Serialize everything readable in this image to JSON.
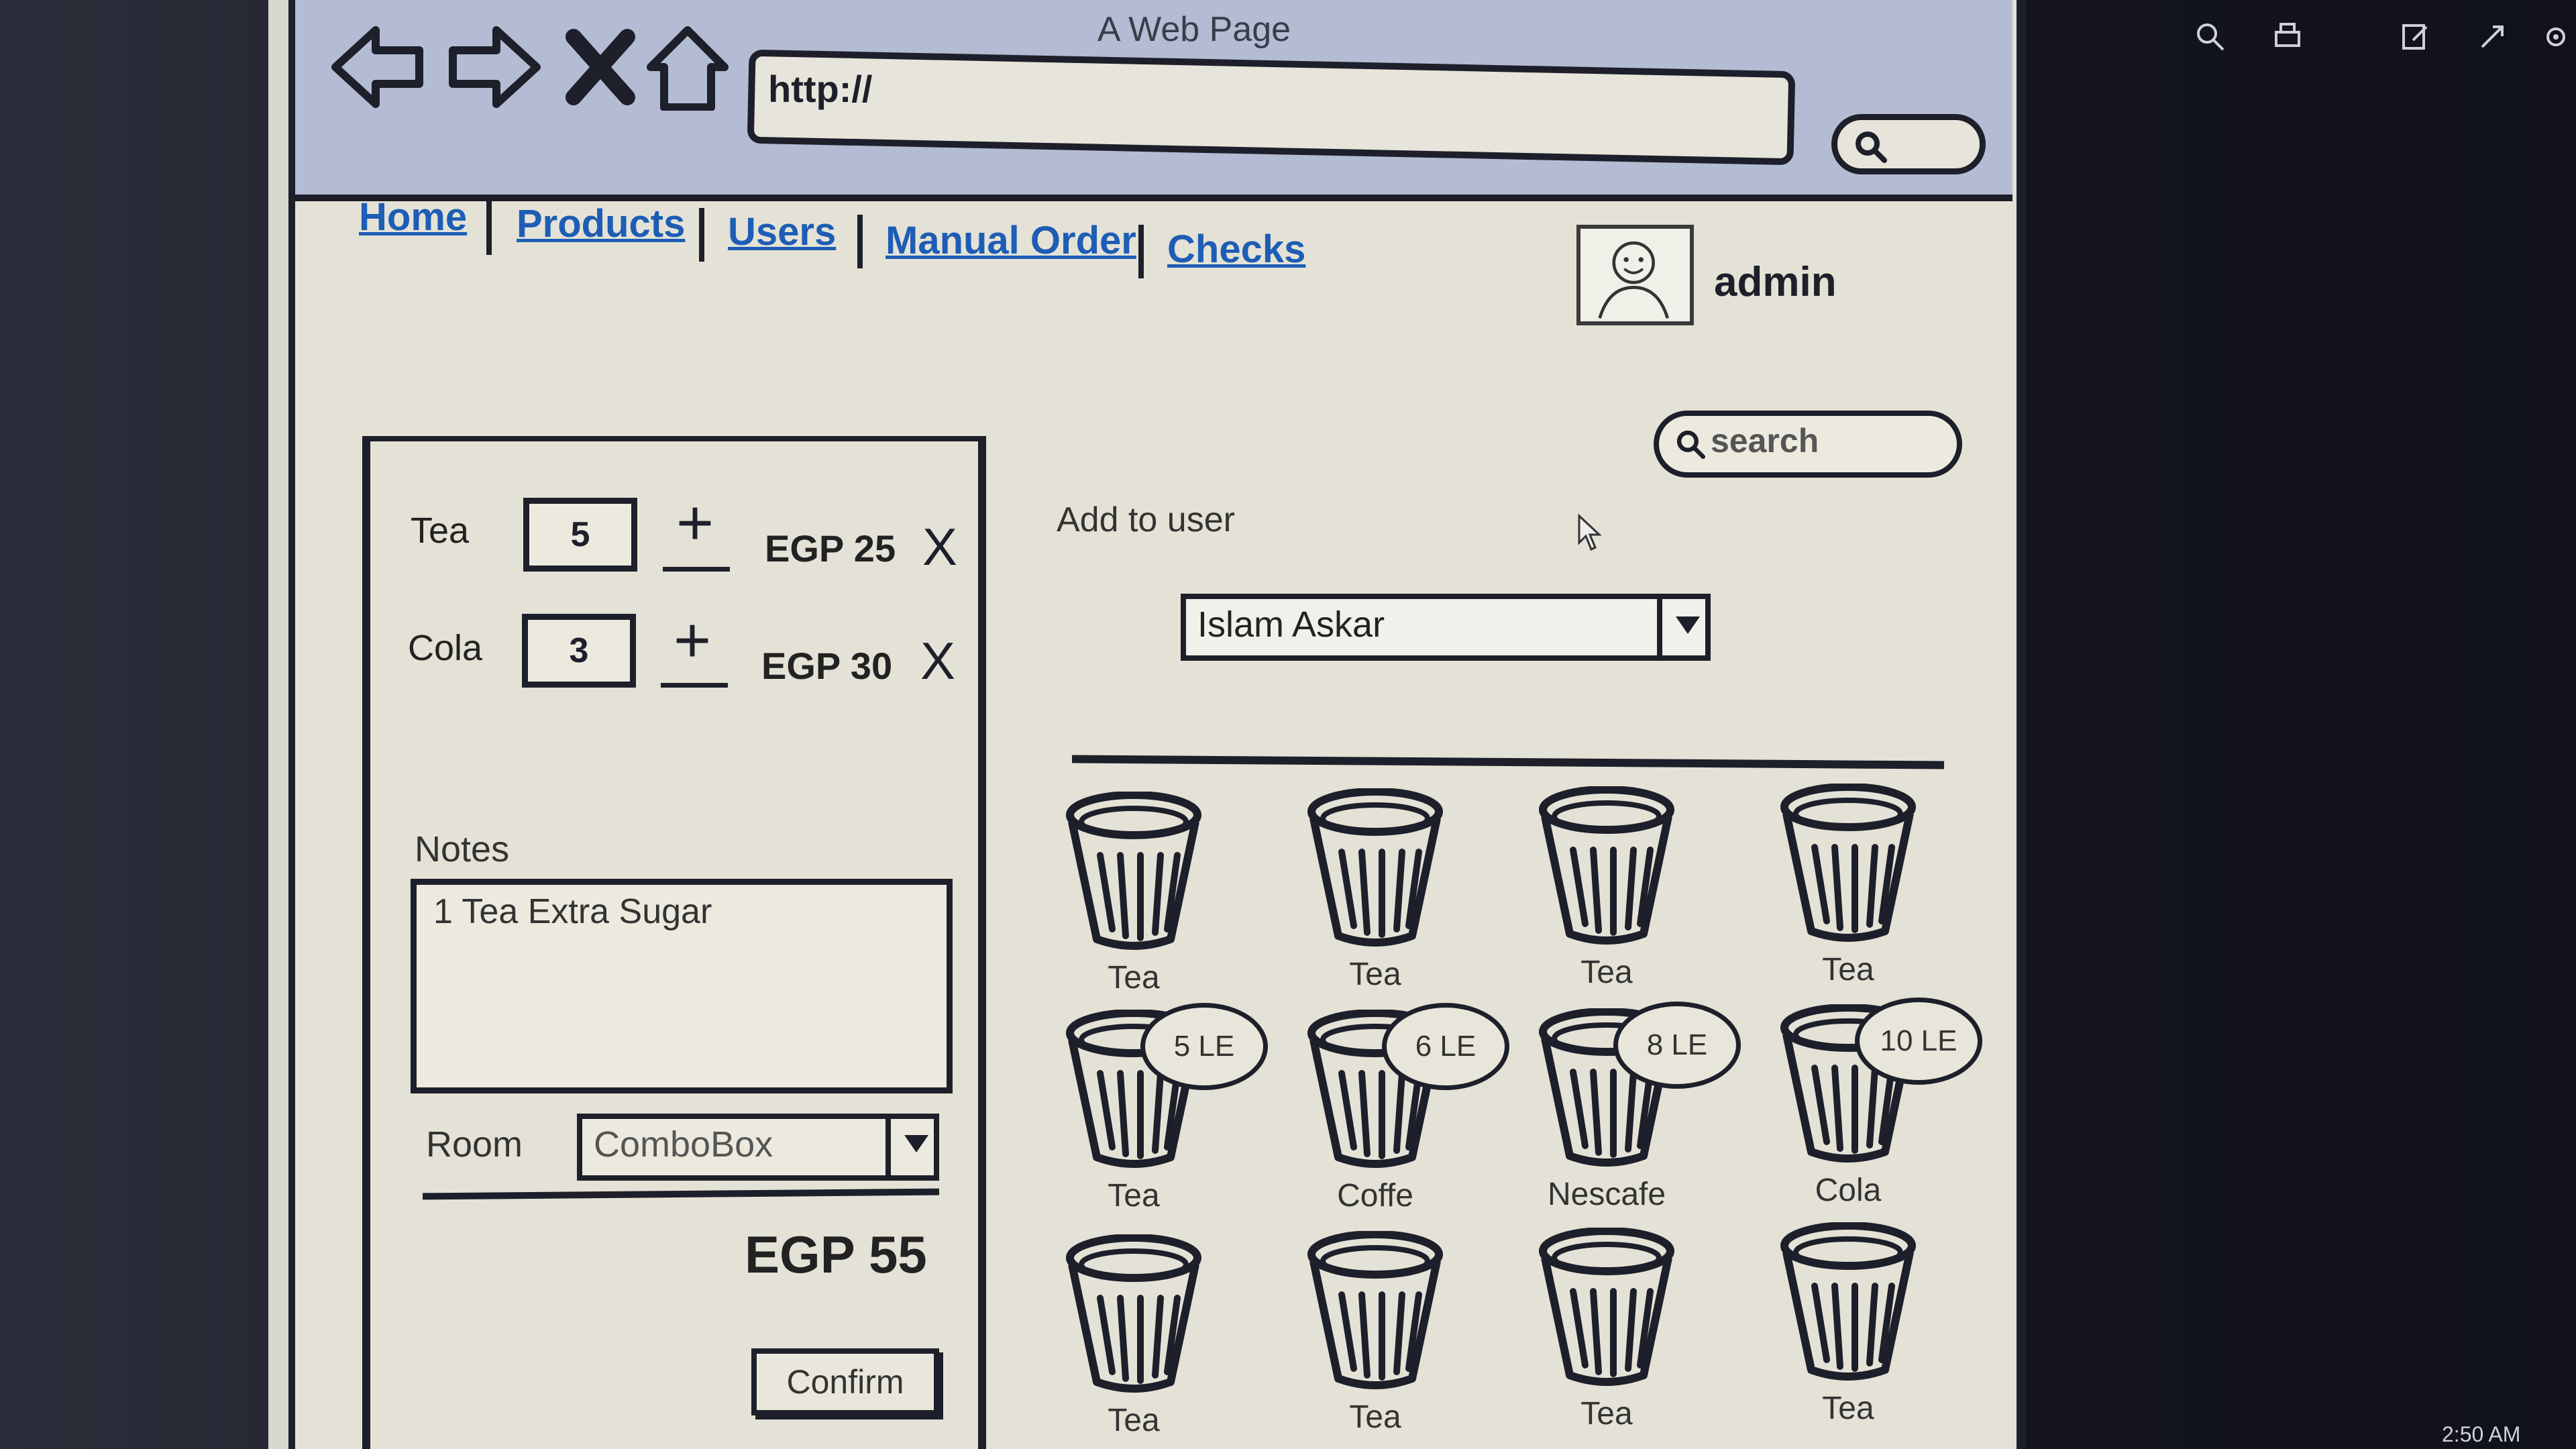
{
  "window": {
    "title": "A Web Page"
  },
  "browser": {
    "url": "http://",
    "icons": [
      "back-arrow-icon",
      "forward-arrow-icon",
      "stop-icon",
      "home-icon",
      "search-icon"
    ]
  },
  "nav": {
    "items": [
      {
        "label": "Home"
      },
      {
        "label": "Products"
      },
      {
        "label": "Users"
      },
      {
        "label": "Manual Order"
      },
      {
        "label": "Checks"
      }
    ]
  },
  "user": {
    "name": "admin"
  },
  "order": {
    "items": [
      {
        "name": "Tea",
        "quantity": "5",
        "price": "EGP 25",
        "remove": "X"
      },
      {
        "name": "Cola",
        "quantity": "3",
        "price": "EGP 30",
        "remove": "X"
      }
    ],
    "notes_label": "Notes",
    "notes_value": "1 Tea Extra Sugar",
    "room_label": "Room",
    "room_value": "ComboBox",
    "total": "EGP 55",
    "confirm_label": "Confirm"
  },
  "search": {
    "placeholder": "search"
  },
  "add_to_user": {
    "label": "Add to user",
    "selected": "Islam Askar"
  },
  "products": [
    {
      "name": "Tea"
    },
    {
      "name": "Tea"
    },
    {
      "name": "Tea"
    },
    {
      "name": "Tea"
    },
    {
      "name": "Tea",
      "price": "5 LE"
    },
    {
      "name": "Coffe",
      "price": "6 LE"
    },
    {
      "name": "Nescafe",
      "price": "8 LE"
    },
    {
      "name": "Cola",
      "price": "10 LE"
    },
    {
      "name": "Tea"
    },
    {
      "name": "Tea"
    },
    {
      "name": "Tea"
    },
    {
      "name": "Tea"
    }
  ],
  "system": {
    "clock": "2:50 AM"
  },
  "colors": {
    "link": "#1d5db5",
    "toolbar": "#b3bcd3",
    "page": "#e4e2d6"
  }
}
